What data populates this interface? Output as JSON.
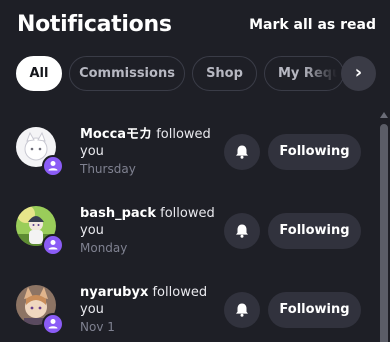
{
  "header": {
    "title": "Notifications",
    "mark_all_label": "Mark all as read"
  },
  "filters": {
    "chips": [
      {
        "label": "All",
        "active": true
      },
      {
        "label": "Commissions",
        "active": false
      },
      {
        "label": "Shop",
        "active": false
      },
      {
        "label": "My Requests",
        "active": false
      }
    ],
    "next_icon": "chevron-right-icon"
  },
  "notifications": [
    {
      "username": "Moccaモカ",
      "action": "followed you",
      "time": "Thursday",
      "button_label": "Following",
      "bell_icon": "bell-icon",
      "badge_icon": "user-icon"
    },
    {
      "username": "bash_pack",
      "action": "followed you",
      "time": "Monday",
      "button_label": "Following",
      "bell_icon": "bell-icon",
      "badge_icon": "user-icon"
    },
    {
      "username": "nyarubyx",
      "action": "followed you",
      "time": "Nov 1",
      "button_label": "Following",
      "bell_icon": "bell-icon",
      "badge_icon": "user-icon"
    }
  ],
  "colors": {
    "background": "#1e1f26",
    "chip_border": "#3a3c47",
    "button_bg": "#31323d",
    "badge": "#8b5cf6",
    "muted_text": "#7f8190"
  }
}
